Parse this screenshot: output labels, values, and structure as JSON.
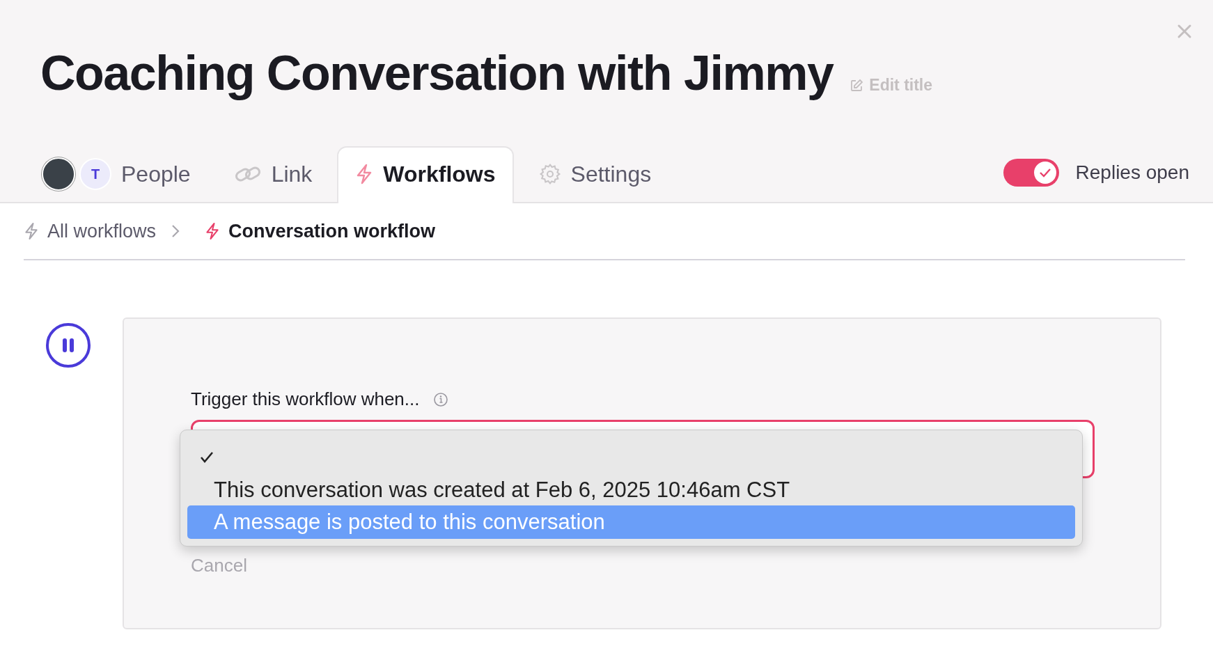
{
  "header": {
    "title": "Coaching Conversation with Jimmy",
    "edit_link": "Edit title"
  },
  "tabs": [
    {
      "kind": "people",
      "label": "People",
      "avatar_initial": "T",
      "selected": false
    },
    {
      "kind": "link",
      "label": "Link",
      "selected": false
    },
    {
      "kind": "workflows",
      "label": "Workflows",
      "selected": true
    },
    {
      "kind": "settings",
      "label": "Settings",
      "selected": false
    }
  ],
  "replies_toggle": {
    "label": "Replies open",
    "on": true
  },
  "breadcrumb": [
    {
      "label": "All workflows",
      "current": false
    },
    {
      "label": "Conversation workflow",
      "current": true
    }
  ],
  "workflow": {
    "paused": false,
    "trigger_label": "Trigger this workflow when...",
    "cancel": "Cancel",
    "menu": [
      {
        "checked": true,
        "selected": false
      },
      {
        "label": "This conversation was created at Feb 6, 2025 10:46am CST",
        "checked": false,
        "selected": false
      },
      {
        "label": "A message is posted to this conversation",
        "checked": false,
        "selected": true
      }
    ]
  }
}
